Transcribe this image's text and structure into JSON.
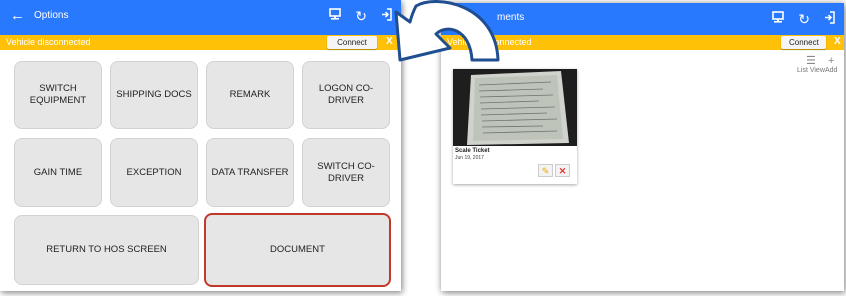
{
  "left": {
    "appbar": {
      "title": "Options"
    },
    "status": {
      "message": "Vehicle disconnected",
      "connect_label": "Connect",
      "close_label": "X"
    },
    "buttons": {
      "switch_equipment": "SWITCH\nEQUIPMENT",
      "shipping_docs": "SHIPPING DOCS",
      "remark": "REMARK",
      "logon_co_driver": "LOGON CO-DRIVER",
      "gain_time": "GAIN TIME",
      "exception": "EXCEPTION",
      "data_transfer": "DATA TRANSFER",
      "switch_co_driver": "SWITCH CO-\nDRIVER",
      "return_to_hos": "RETURN TO HOS SCREEN",
      "document": "DOCUMENT"
    }
  },
  "right": {
    "appbar": {
      "title_visible": "ments"
    },
    "status": {
      "message": "Vehicle disconnected",
      "connect_label": "Connect",
      "close_label": "X"
    },
    "toolbar": {
      "list_view_label": "List View",
      "add_label": "Add"
    },
    "document": {
      "title": "Scale Ticket",
      "date": "Jun 19, 2017"
    }
  },
  "colors": {
    "appbar": "#2979ff",
    "status_bar": "#ffc107",
    "highlight": "#c0392b",
    "arrow": "#1f4e91"
  }
}
